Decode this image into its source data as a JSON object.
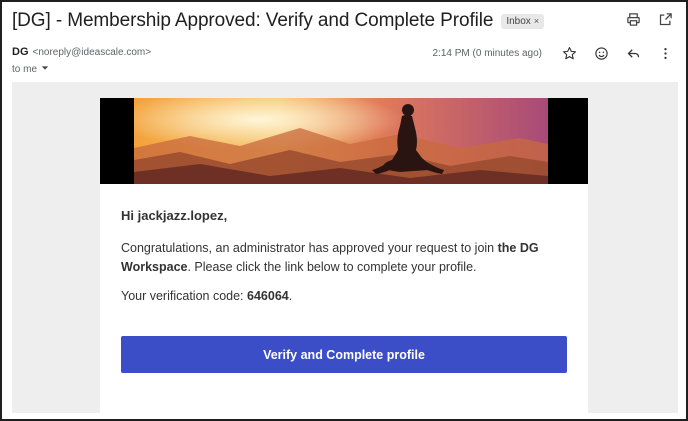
{
  "email": {
    "subject": "[DG] - Membership Approved: Verify and Complete Profile",
    "label": "Inbox",
    "sender_name": "DG",
    "sender_email": "<noreply@ideascale.com>",
    "recipient": "to me",
    "timestamp": "2:14 PM (0 minutes ago)"
  },
  "body": {
    "greeting": "Hi jackjazz.lopez,",
    "para_prefix": "Congratulations, an administrator has approved your request to join ",
    "para_bold": "the DG Workspace",
    "para_suffix": ". Please click the link below to complete your profile.",
    "code_prefix": "Your verification code: ",
    "code_value": "646064",
    "code_suffix": ".",
    "cta_label": "Verify and Complete profile"
  },
  "icons": {
    "print": "printer-icon",
    "popout": "open-in-new-icon",
    "star": "star-icon",
    "emoji": "emoji-icon",
    "reply": "reply-icon",
    "more": "more-vert-icon",
    "dropdown": "caret-down-icon",
    "remove_label": "close-icon"
  },
  "colors": {
    "cta": "#3b4ec7",
    "canvas": "#eeeeee"
  }
}
